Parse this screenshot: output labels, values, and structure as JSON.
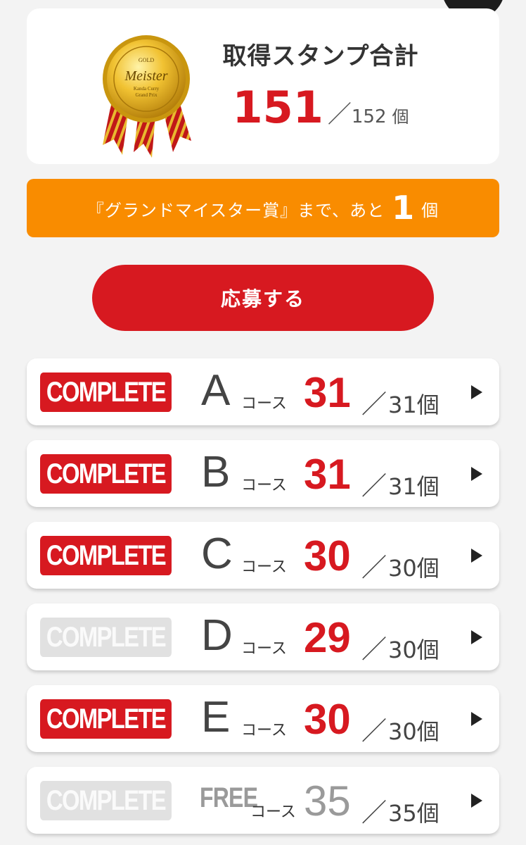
{
  "summary": {
    "title": "取得スタンプ合計",
    "count": "151",
    "slash": "／",
    "total": "152",
    "unit": "個",
    "medal": {
      "icon": "gold-medal-icon",
      "top_text": "GOLD",
      "main_text": "Meister",
      "sub_lines": [
        "Kanda Curry",
        "Grand Prix"
      ]
    }
  },
  "notice": {
    "prefix": "『グランドマイスター賞』まで、あと",
    "remaining": "1",
    "unit": "個"
  },
  "apply_button": {
    "label": "応募する"
  },
  "courses": [
    {
      "badge": "COMPLETE",
      "complete": true,
      "letter": "A",
      "word": "コース",
      "count": "31",
      "total": "31個"
    },
    {
      "badge": "COMPLETE",
      "complete": true,
      "letter": "B",
      "word": "コース",
      "count": "31",
      "total": "31個"
    },
    {
      "badge": "COMPLETE",
      "complete": true,
      "letter": "C",
      "word": "コース",
      "count": "30",
      "total": "30個"
    },
    {
      "badge": "COMPLETE",
      "complete": false,
      "letter": "D",
      "word": "コース",
      "count": "29",
      "total": "30個"
    },
    {
      "badge": "COMPLETE",
      "complete": true,
      "letter": "E",
      "word": "コース",
      "count": "30",
      "total": "30個"
    },
    {
      "badge": "COMPLETE",
      "complete": false,
      "letter": "FREE",
      "word": "コース",
      "count": "35",
      "total": "35個"
    }
  ],
  "colors": {
    "accent_red": "#d71920",
    "notice_orange": "#f98c00",
    "badge_off": "#e1e1e1",
    "background": "#f3f3f3"
  }
}
